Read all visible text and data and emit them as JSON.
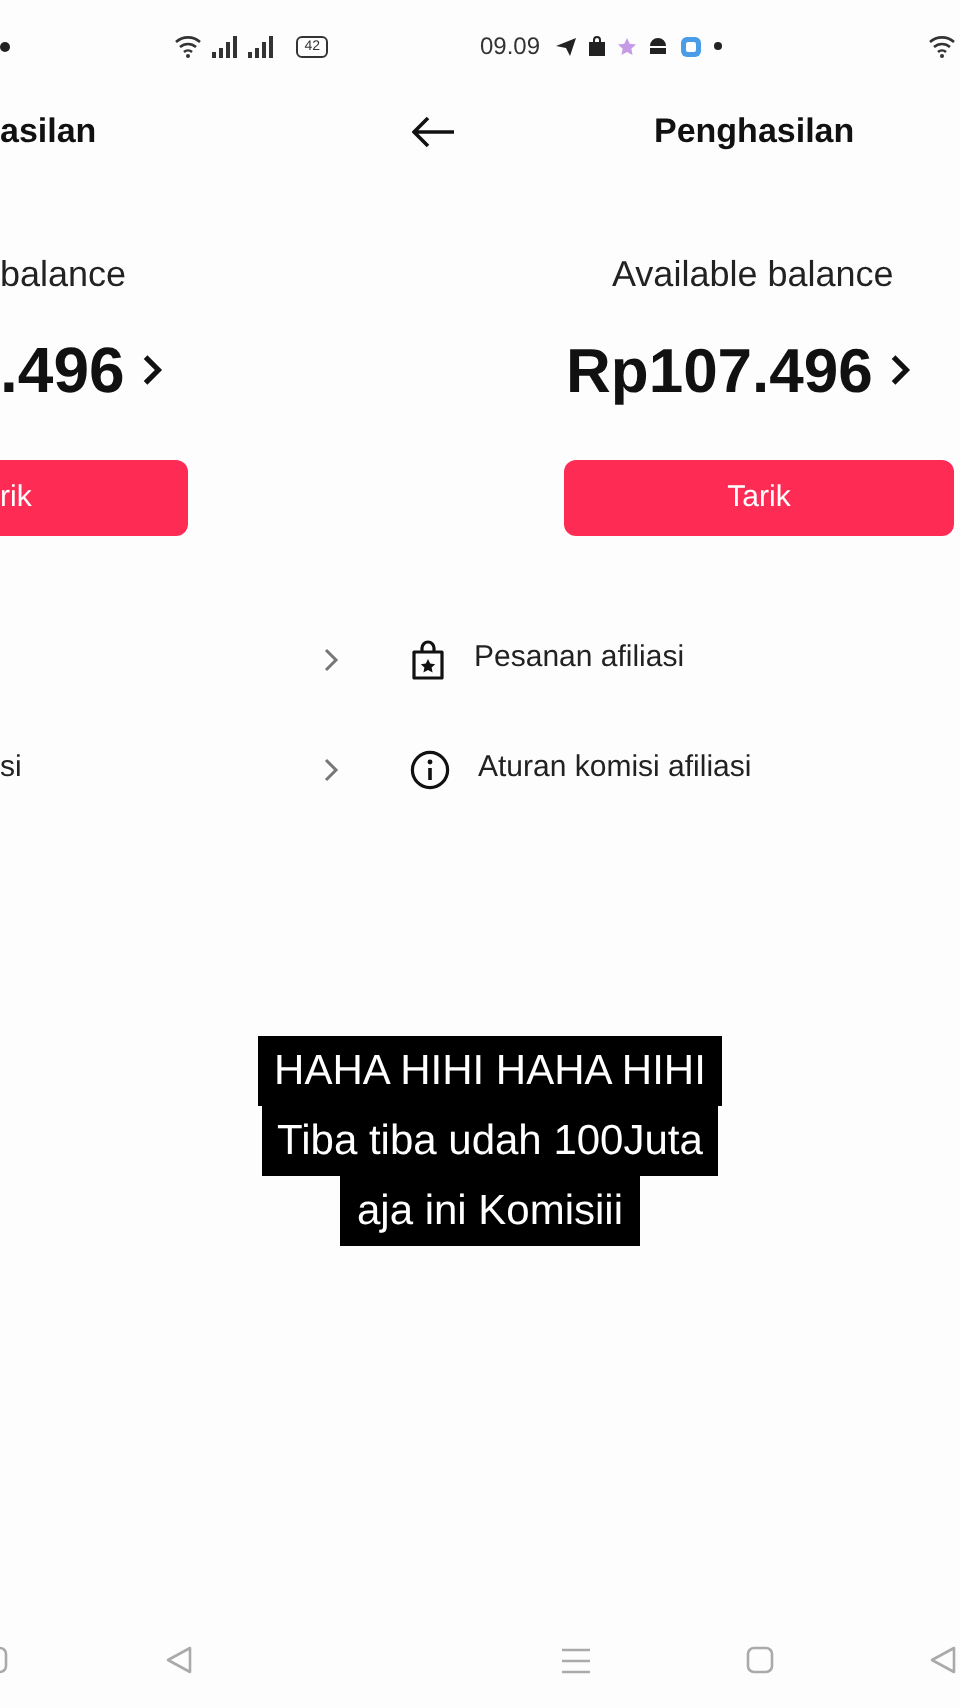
{
  "left_screen": {
    "battery": "42",
    "title": "asilan",
    "balance_label": "balance",
    "balance_amount": ".496",
    "withdraw_button": "rik",
    "menu_rows": [
      {
        "kind": "chevron_only"
      },
      {
        "kind": "labeled",
        "label": "si"
      }
    ]
  },
  "right_screen": {
    "clock": "09.09",
    "title": "Penghasilan",
    "balance_label": "Available balance",
    "balance_amount": "Rp107.496",
    "withdraw_button": "Tarik",
    "menu_items": [
      {
        "kind": "orders",
        "label": "Pesanan afiliasi"
      },
      {
        "kind": "info",
        "label": "Aturan komisi afiliasi"
      }
    ]
  },
  "caption": {
    "lines": [
      "HAHA HIHI HAHA HIHI",
      "Tiba tiba udah 100Juta",
      "aja ini Komisiii"
    ]
  }
}
